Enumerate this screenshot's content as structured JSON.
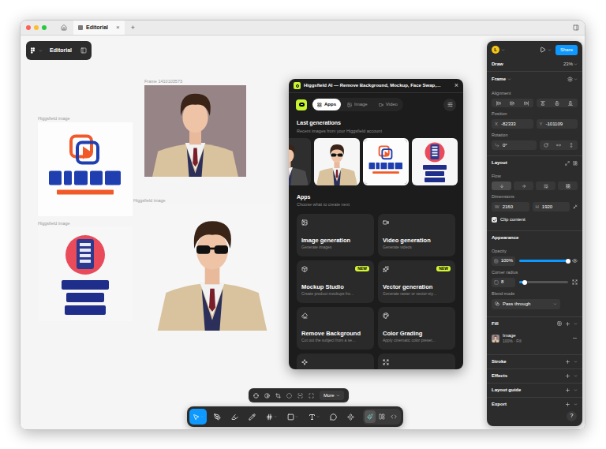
{
  "window": {
    "tab": "Editorial",
    "tab_close": "×",
    "new_tab": "+"
  },
  "file_menu": {
    "title": "Editorial"
  },
  "canvas": {
    "frames": [
      {
        "label": "Higgsfield image",
        "kind": "logo-video"
      },
      {
        "label": "Higgsfield image",
        "kind": "logo-splitflap"
      },
      {
        "label": "Frame 1410103573",
        "kind": "photo-suit"
      },
      {
        "label": "Higgsfield image",
        "kind": "photo-sunglasses"
      }
    ]
  },
  "plugin": {
    "title": "Higgsfield AI — Remove Background, Mockup, Face Swap,…",
    "close": "×",
    "tabs": [
      {
        "label": "Apps",
        "selected": true
      },
      {
        "label": "Image",
        "selected": false
      },
      {
        "label": "Video",
        "selected": false
      }
    ],
    "last_generations": {
      "title": "Last generations",
      "subtitle": "Recent images from your Higgsfield account",
      "items": [
        {
          "kind": "photo-dark",
          "selected": false
        },
        {
          "kind": "photo-sunglasses",
          "selected": false
        },
        {
          "kind": "logo-video",
          "selected": true
        },
        {
          "kind": "logo-splitflap",
          "selected": false
        }
      ]
    },
    "apps": {
      "title": "Apps",
      "subtitle": "Choose what to create next",
      "items": [
        {
          "title": "Image generation",
          "description": "Generate images",
          "badge": ""
        },
        {
          "title": "Video generation",
          "description": "Generate videos",
          "badge": ""
        },
        {
          "title": "Mockup Studio",
          "description": "Create product mockups fro…",
          "badge": "NEW"
        },
        {
          "title": "Vector generation",
          "description": "Generate raster or vector-sty…",
          "badge": "NEW"
        },
        {
          "title": "Remove Background",
          "description": "Cut out the subject from a se…",
          "badge": ""
        },
        {
          "title": "Color Grading",
          "description": "Apply cinematic color preset…",
          "badge": ""
        }
      ]
    }
  },
  "properties": {
    "avatar": "L",
    "share": "Share",
    "draw": {
      "label": "Draw",
      "zoom": "23%"
    },
    "frame": {
      "label": "Frame"
    },
    "alignment": {
      "label": "Alignment"
    },
    "position": {
      "label": "Position",
      "x_label": "X",
      "x": "-82333",
      "y_label": "Y",
      "y": "-101109"
    },
    "rotation": {
      "label": "Rotation",
      "value": "0°"
    },
    "layout": {
      "label": "Layout",
      "flow_label": "Flow",
      "flow": [
        {
          "selected": true
        },
        {
          "selected": false
        },
        {
          "selected": false
        },
        {
          "selected": false
        }
      ],
      "dimensions_label": "Dimensions",
      "w_label": "W",
      "w": "2160",
      "h_label": "H",
      "h": "1920",
      "clip": {
        "label": "Clip content",
        "checked": true
      }
    },
    "appearance": {
      "label": "Appearance",
      "opacity": {
        "label": "Opacity",
        "value": "100%",
        "level": 1
      },
      "corner": {
        "label": "Corner radius",
        "value": "8",
        "level": 0.12
      },
      "blend": {
        "label": "Blend mode",
        "value": "Pass through"
      }
    },
    "fill": {
      "label": "Fill",
      "items": [
        {
          "name": "Image",
          "detail": "100% · Fill"
        }
      ]
    },
    "sections": [
      "Stroke",
      "Effects",
      "Layout guide",
      "Export"
    ],
    "help": "?"
  },
  "context_toolbar": {
    "more": "More"
  },
  "main_toolbar": {
    "tools": [
      {
        "selected": true
      },
      {
        "selected": false
      },
      {
        "selected": false
      },
      {
        "selected": false
      },
      {
        "selected": false
      },
      {
        "selected": false
      },
      {
        "selected": false
      },
      {
        "selected": false
      },
      {
        "selected": false
      }
    ],
    "modes": [
      {
        "selected": true
      },
      {
        "selected": false
      },
      {
        "selected": false
      }
    ]
  }
}
